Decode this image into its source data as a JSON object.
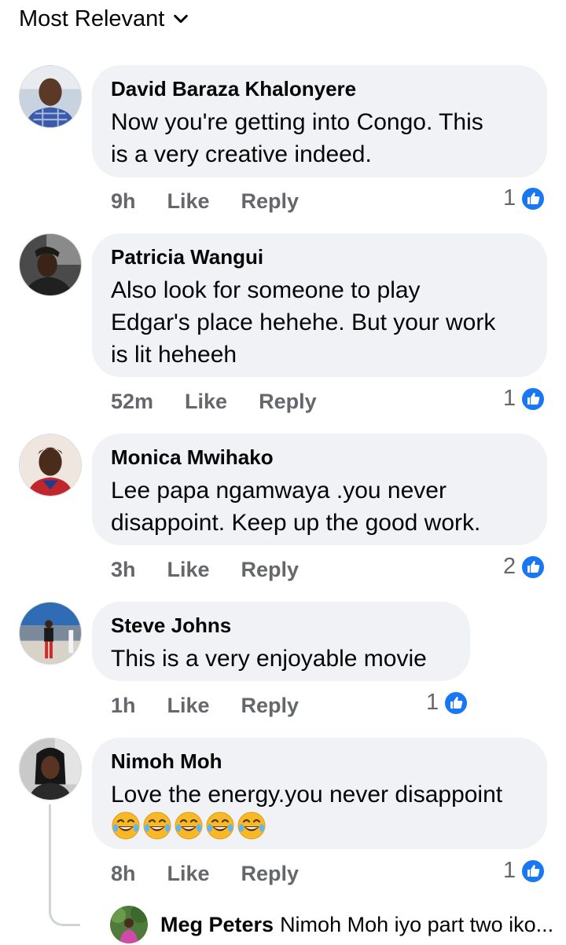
{
  "header": {
    "sort_label": "Most Relevant",
    "sort_icon": "chevron-down-icon"
  },
  "comments": [
    {
      "name": "David Baraza Khalonyere",
      "text_lines": [
        "Now you're getting into Congo. This",
        "is a very creative indeed."
      ],
      "time": "9h",
      "like_label": "Like",
      "reply_label": "Reply",
      "reactions": "1"
    },
    {
      "name": "Patricia Wangui",
      "text_lines": [
        "Also look for someone to play",
        "Edgar's place hehehe. But your work",
        "is lit heheeh"
      ],
      "time": "52m",
      "like_label": "Like",
      "reply_label": "Reply",
      "reactions": "1"
    },
    {
      "name": "Monica Mwihako",
      "text_lines": [
        "Lee papa ngamwaya .you never",
        "disappoint. Keep up the good work."
      ],
      "time": "3h",
      "like_label": "Like",
      "reply_label": "Reply",
      "reactions": "2"
    },
    {
      "name": "Steve Johns",
      "text_lines": [
        "This is a very enjoyable movie"
      ],
      "time": "1h",
      "like_label": "Like",
      "reply_label": "Reply",
      "reactions": "1"
    },
    {
      "name": "Nimoh Moh",
      "text_lines": [
        "Love the energy.you never disappoint"
      ],
      "emoji": [
        "rolling-laughing-emoji",
        "rolling-laughing-emoji",
        "rolling-laughing-emoji",
        "rolling-laughing-emoji",
        "rolling-laughing-emoji"
      ],
      "time": "8h",
      "like_label": "Like",
      "reply_label": "Reply",
      "reactions": "1"
    }
  ],
  "reply_preview": {
    "name": "Meg Peters",
    "text": "Nimoh Moh iyo part two iko..."
  },
  "colors": {
    "bubble": "#f0f2f5",
    "like_blue": "#1877f2",
    "meta_gray": "#65676b"
  }
}
